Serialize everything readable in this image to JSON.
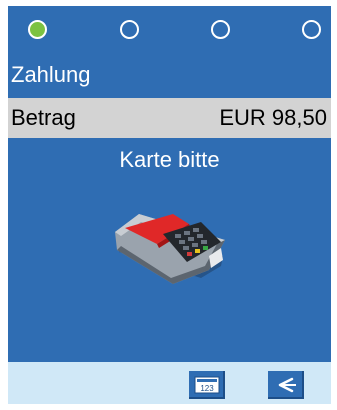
{
  "status": {
    "steps": [
      {
        "state": "active",
        "color": "#7cc242"
      },
      {
        "state": "inactive"
      },
      {
        "state": "inactive"
      },
      {
        "state": "inactive"
      }
    ]
  },
  "screen": {
    "title": "Zahlung",
    "amount_label": "Betrag",
    "amount_value": "EUR 98,50",
    "prompt": "Karte bitte",
    "illustration_icon": "card-terminal-icon"
  },
  "softkeys": {
    "numeric_label": "123",
    "numeric_icon": "numeric-keypad-icon",
    "back_icon": "back-arrow-icon"
  },
  "colors": {
    "screen_bg": "#2f6db3",
    "amount_row_bg": "#d3d3d3",
    "bottom_bar_bg": "#d0e8f7",
    "active_step": "#7cc242"
  }
}
